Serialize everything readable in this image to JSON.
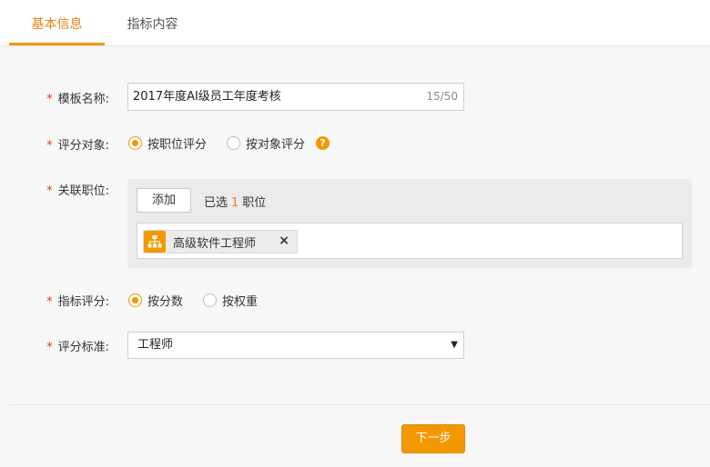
{
  "tabs": [
    {
      "label": "基本信息",
      "active": true
    },
    {
      "label": "指标内容",
      "active": false
    }
  ],
  "form": {
    "required_mark": "*",
    "template_name": {
      "label": "模板名称:",
      "value": "2017年度AI级员工年度考核",
      "counter": "15/50"
    },
    "rating_target": {
      "label": "评分对象:",
      "options": [
        "按职位评分",
        "按对象评分"
      ],
      "selected": "按职位评分",
      "help_icon": "question-circle-icon"
    },
    "linked_positions": {
      "label": "关联职位:",
      "add_label": "添加",
      "selected_prefix": "已选",
      "selected_count": "1",
      "selected_suffix": "职位",
      "tags": [
        {
          "icon": "org-chart-icon",
          "label": "高级软件工程师",
          "remove_label": "×"
        }
      ]
    },
    "indicator_scoring": {
      "label": "指标评分:",
      "options": [
        "按分数",
        "按权重"
      ],
      "selected": "按分数"
    },
    "rating_standard": {
      "label": "评分标准:",
      "value": "工程师",
      "arrow": "▼"
    }
  },
  "footer": {
    "next_label": "下一步"
  },
  "colors": {
    "accent": "#f39800",
    "required": "#e8340f",
    "tab_active": "#e8830f"
  }
}
